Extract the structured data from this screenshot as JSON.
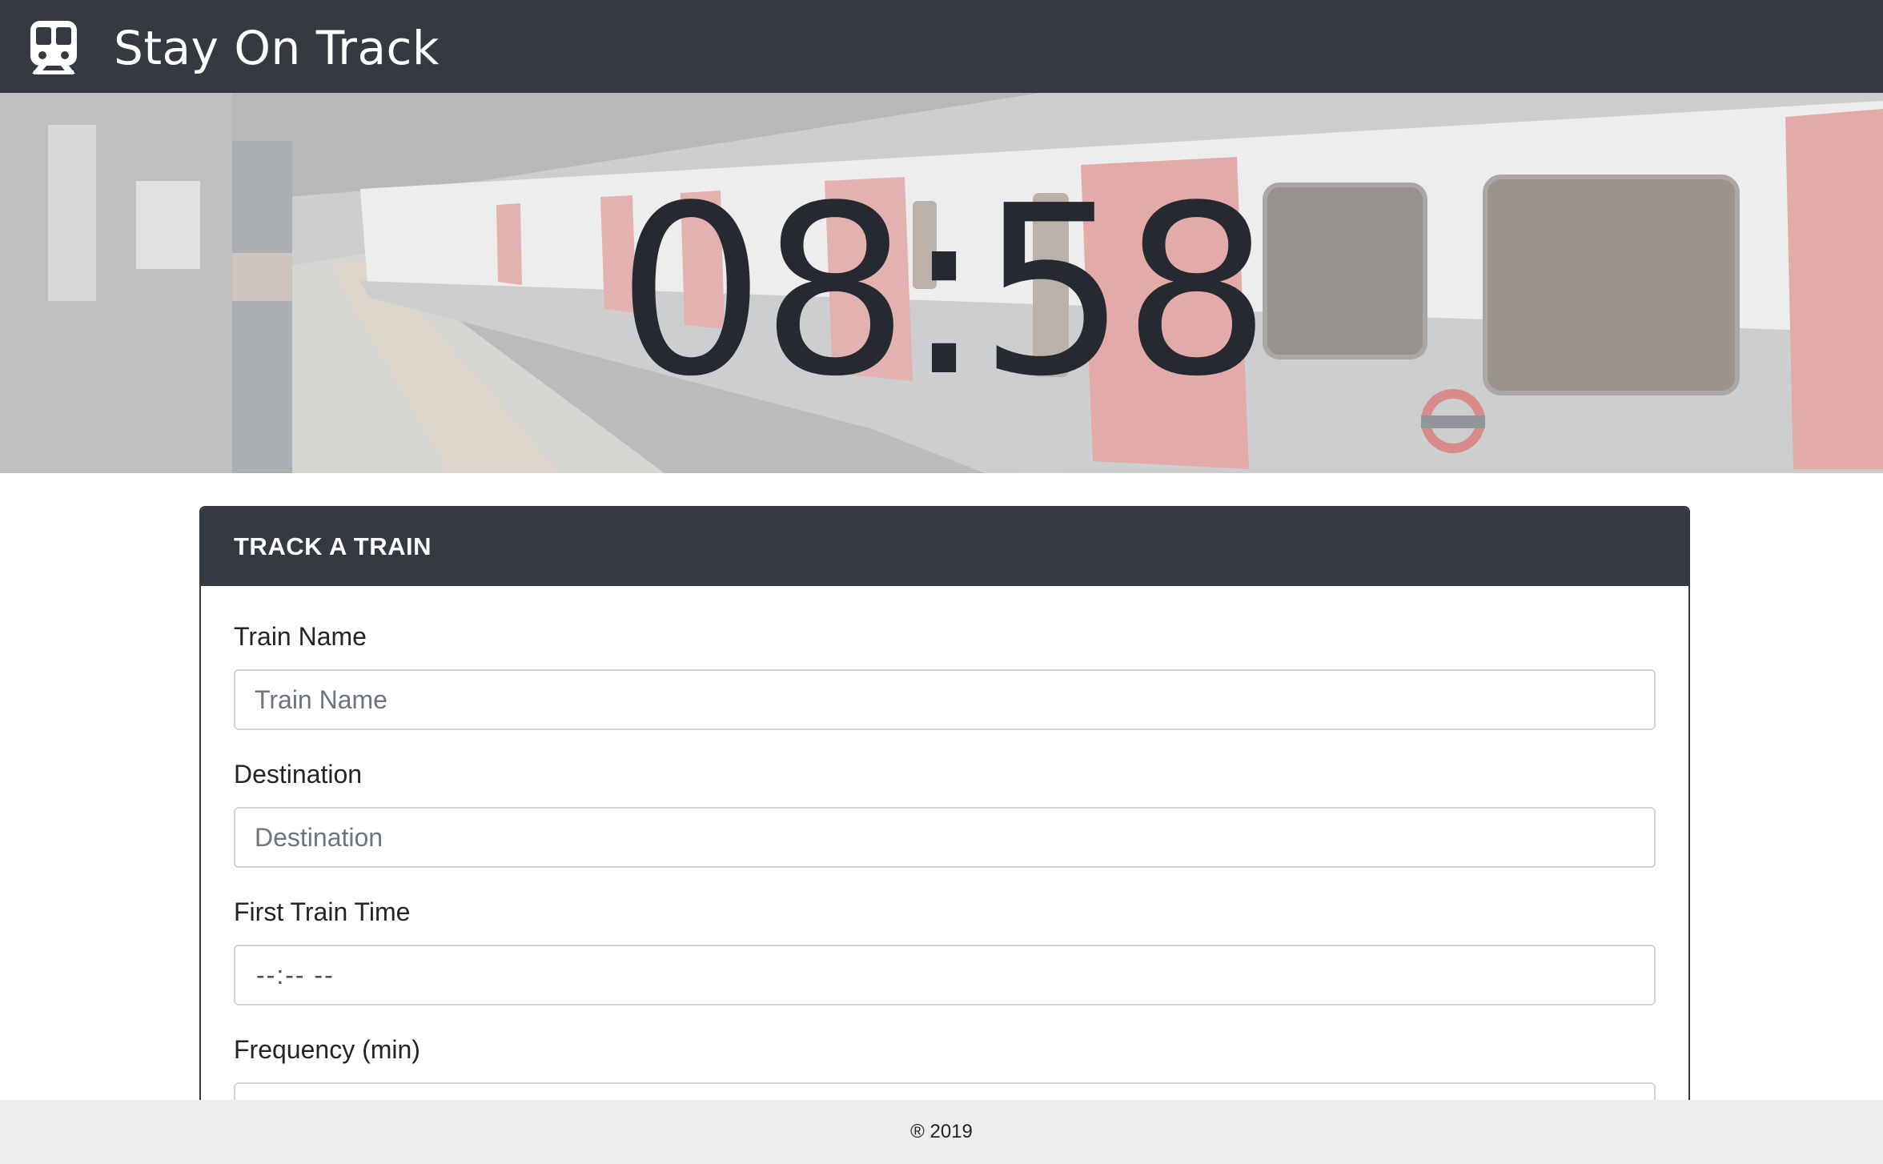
{
  "navbar": {
    "brand_icon": "subway-train-icon",
    "title": "Stay On Track"
  },
  "hero": {
    "clock": "08:58",
    "background": "subway-train-photo"
  },
  "form": {
    "header": "TRACK A TRAIN",
    "train_name": {
      "label": "Train Name",
      "placeholder": "Train Name"
    },
    "destination": {
      "label": "Destination",
      "placeholder": "Destination"
    },
    "first_train_time": {
      "label": "First Train Time",
      "value": "--:-- --"
    },
    "frequency": {
      "label": "Frequency (min)"
    }
  },
  "footer": {
    "text": "® 2019"
  },
  "colors": {
    "dark": "#343a40",
    "footer_bg": "#eeeeee",
    "train_red": "#d9524e"
  }
}
